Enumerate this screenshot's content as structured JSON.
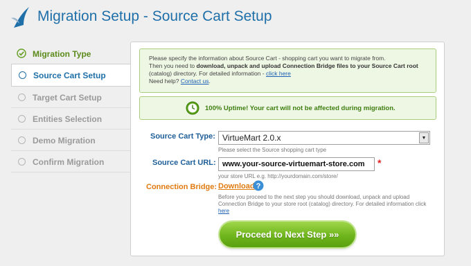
{
  "header": {
    "title": "Migration Setup - Source Cart Setup"
  },
  "sidebar": {
    "steps": [
      {
        "label": "Migration Type",
        "state": "done"
      },
      {
        "label": "Source Cart Setup",
        "state": "active"
      },
      {
        "label": "Target Cart Setup",
        "state": "pending"
      },
      {
        "label": "Entities Selection",
        "state": "pending"
      },
      {
        "label": "Demo Migration",
        "state": "pending"
      },
      {
        "label": "Confirm Migration",
        "state": "pending"
      }
    ]
  },
  "info": {
    "line1": "Please specify the information about Source Cart - shopping cart you want to migrate from.",
    "line2_prefix": "Then you need to ",
    "line2_bold": "download, unpack and upload Connection Bridge files to your Source Cart root",
    "line3_prefix": "(catalog) directory. For detailed information - ",
    "line3_link": "click here",
    "help_prefix": "Need help? ",
    "help_link": "Contact us",
    "help_suffix": "."
  },
  "uptime": {
    "text": "100% Uptime! Your cart will not be affected during migration."
  },
  "form": {
    "source_type_label": "Source Cart Type:",
    "source_type_value": "VirtueMart 2.0.x",
    "source_type_hint": "Please select the Source shopping cart type",
    "source_url_label": "Source Cart URL:",
    "source_url_value": "www.your-source-virtuemart-store.com",
    "source_url_hint": "your store URL e.g. http://yourdomain.com/store/",
    "required_mark": "*",
    "bridge_label": "Connection Bridge:",
    "bridge_link": "Download",
    "bridge_desc": "Before you proceed to the next step you should download, unpack and upload Connection Bridge to your store root (catalog) directory. For detailed information click",
    "bridge_desc_link": "here"
  },
  "actions": {
    "proceed_label": "Proceed to Next Step »»"
  },
  "colors": {
    "accent": "#1f6fa9",
    "done_green": "#5b8a1a",
    "bridge_orange": "#e07a10",
    "button_green": "#6fb51c"
  }
}
